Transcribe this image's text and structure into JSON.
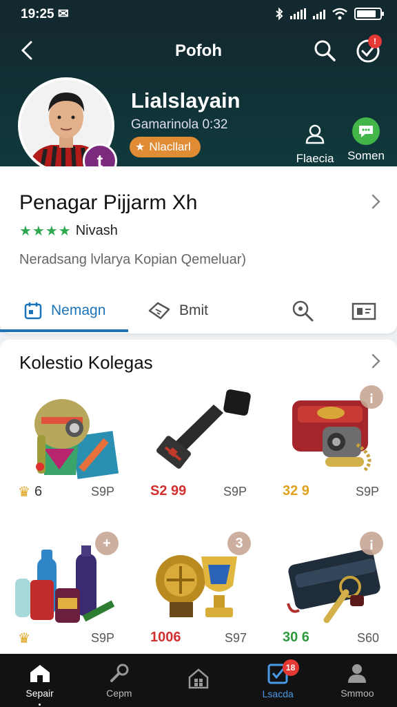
{
  "status": {
    "time": "19:25 ✉"
  },
  "header": {
    "title": "Pofoh",
    "user_name": "Lialslayain",
    "user_sub": "Gamarinola 0:32",
    "level_label": "Nlacllarl",
    "avatar_badge": "t",
    "notif_count": "!",
    "action_a": "Flaecia",
    "action_b": "Somen"
  },
  "card": {
    "title": "Penagar Pijjarm Xh",
    "stars": "★★★★",
    "rating_label": "Nivash",
    "description": "Neradsang lvlarya Kopian Qemeluar)"
  },
  "tabs": [
    {
      "label": "Nemagn",
      "icon": "calendar-icon",
      "active": true
    },
    {
      "label": "Bmit",
      "icon": "ticket-icon",
      "active": false
    },
    {
      "label": "",
      "icon": "search-icon",
      "active": false
    },
    {
      "label": "",
      "icon": "gallery-icon",
      "active": false
    }
  ],
  "collection": {
    "title": "Kolestio Kolegas",
    "items": [
      {
        "icon": "robot-figure-icon",
        "price_left": "6",
        "price_left_color": "#333333",
        "price_right": "S9P",
        "badge": ""
      },
      {
        "icon": "usb-connector-icon",
        "price_left": "S2 99",
        "price_left_color": "#d32f2f",
        "price_right": "S9P",
        "badge": ""
      },
      {
        "icon": "red-device-icon",
        "price_left": "32 9",
        "price_left_color": "#e0a11a",
        "price_right": "S9P",
        "badge": "¡"
      },
      {
        "icon": "bottles-icon",
        "price_left": "",
        "price_left_color": "#333333",
        "price_right": "S9P",
        "badge": "+"
      },
      {
        "icon": "trophy-icon",
        "price_left": "1006",
        "price_left_color": "#d32f2f",
        "price_right": "S97",
        "badge": "3"
      },
      {
        "icon": "wallet-keys-icon",
        "price_left": "30 6",
        "price_left_color": "#2e9a3e",
        "price_right": "S60",
        "badge": "¡"
      }
    ]
  },
  "nav": [
    {
      "label": "Sepair",
      "icon": "home-icon"
    },
    {
      "label": "Cepm",
      "icon": "wrench-icon"
    },
    {
      "label": "",
      "icon": "store-icon"
    },
    {
      "label": "Lsacda",
      "icon": "tasks-icon",
      "badge": "18"
    },
    {
      "label": "Smmoo",
      "icon": "profile-icon"
    }
  ],
  "colors": {
    "header_bg": "#12292f",
    "accent_blue": "#1c73b7",
    "level_orange": "#e08c35",
    "star_green": "#2fa84f",
    "badge_red": "#e53935"
  }
}
